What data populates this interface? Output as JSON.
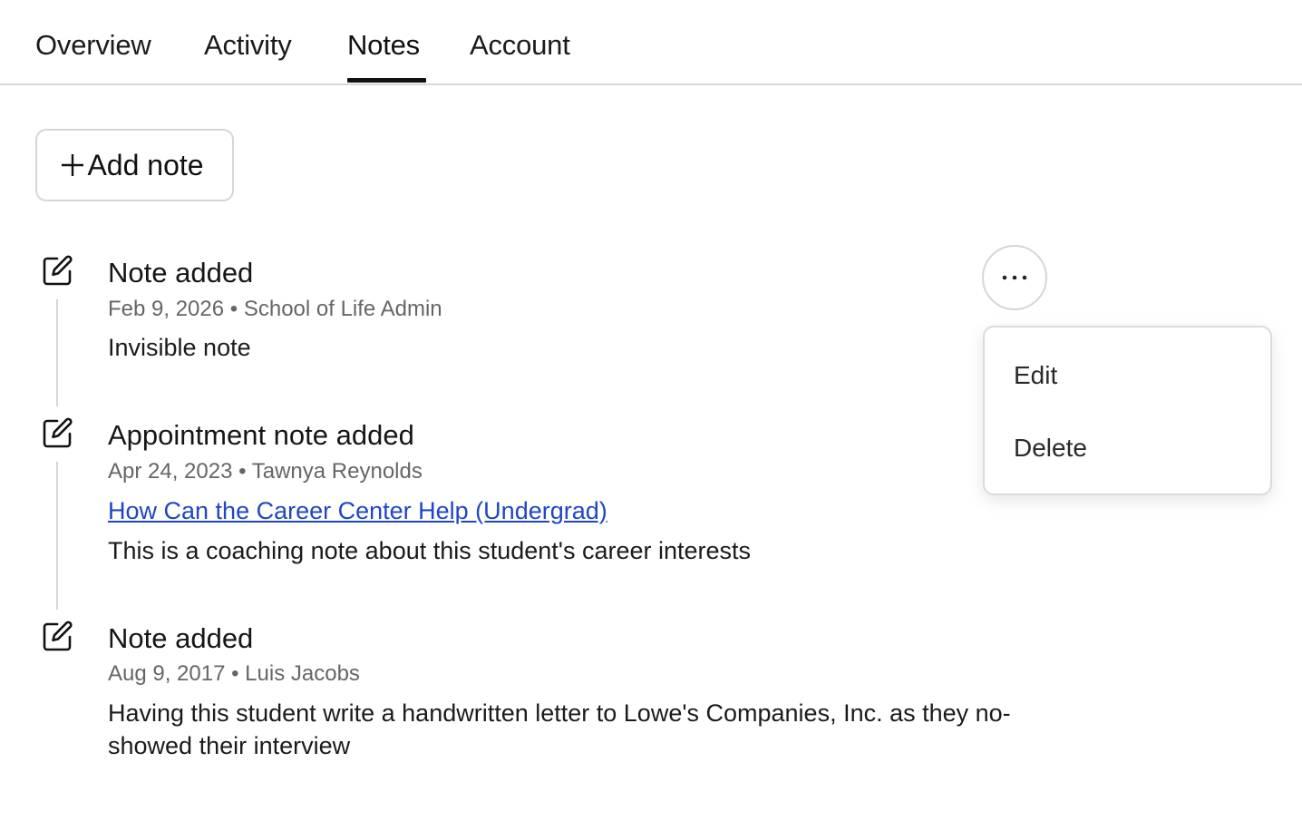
{
  "tabs": [
    {
      "label": "Overview"
    },
    {
      "label": "Activity"
    },
    {
      "label": "Notes"
    },
    {
      "label": "Account"
    }
  ],
  "active_tab": "Notes",
  "add_note_label": "Add note",
  "notes": [
    {
      "title": "Note added",
      "date": "Feb 9, 2026",
      "author": "School of Life Admin",
      "meta": "Feb 9, 2026 • School of Life Admin",
      "body": "Invisible note",
      "icon": "edit-icon"
    },
    {
      "title": "Appointment note added",
      "date": "Apr 24, 2023",
      "author": "Tawnya Reynolds",
      "meta": "Apr 24, 2023 • Tawnya Reynolds",
      "link": "How Can the Career Center Help (Undergrad)",
      "body": "This is a coaching note about this student's career interests",
      "icon": "edit-icon"
    },
    {
      "title": "Note added",
      "date": "Aug 9, 2017",
      "author": "Luis Jacobs",
      "meta": "Aug 9, 2017 • Luis Jacobs",
      "body": "Having this student write a handwritten letter to Lowe's Companies, Inc. as they no-showed their interview",
      "icon": "edit-icon"
    }
  ],
  "menu": {
    "items": [
      {
        "label": "Edit"
      },
      {
        "label": "Delete"
      }
    ],
    "trigger_icon": "more-horizontal-icon"
  },
  "colors": {
    "link": "#1f46c5",
    "divider": "#d6d6d6",
    "meta_text": "#666666"
  }
}
